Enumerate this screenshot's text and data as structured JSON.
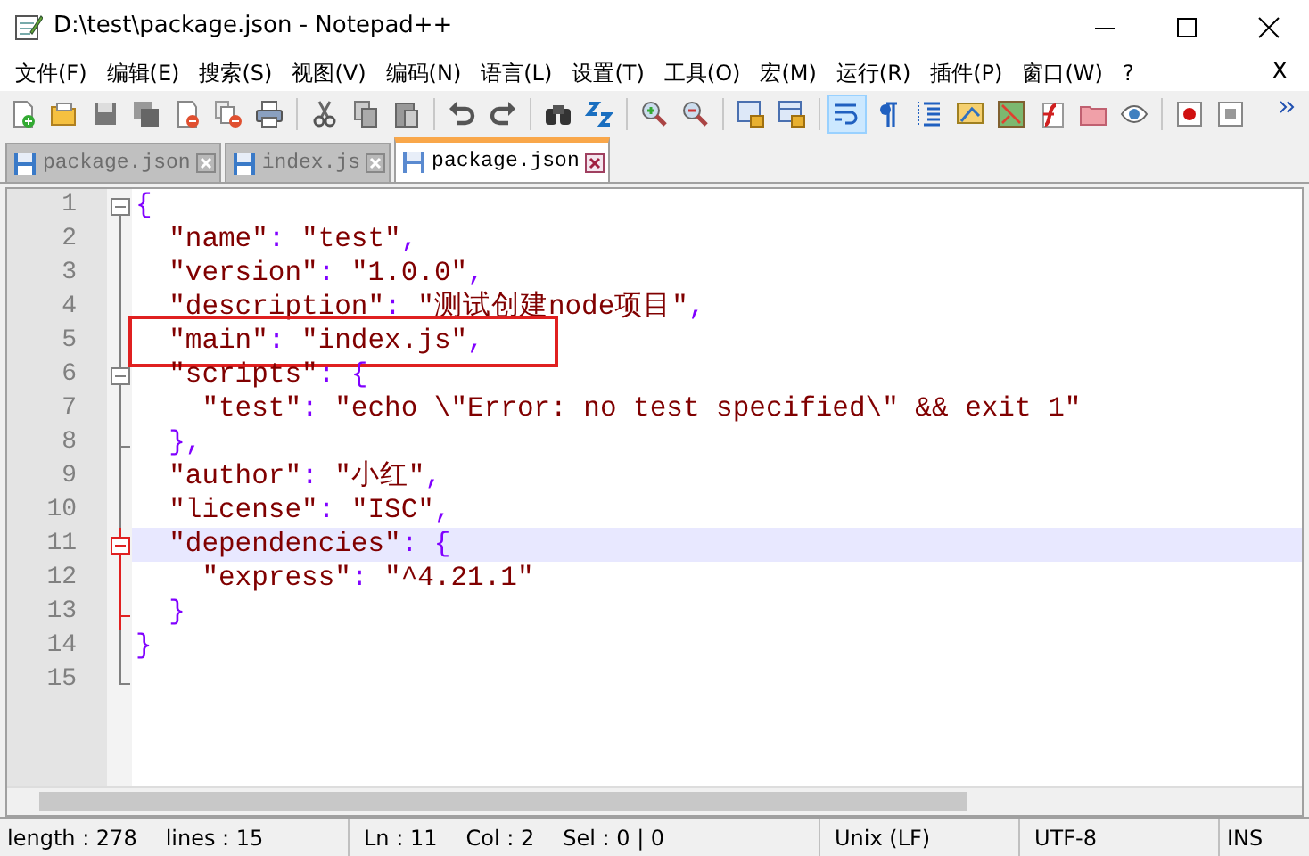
{
  "window": {
    "title": "D:\\test\\package.json - Notepad++"
  },
  "menu": [
    {
      "label": "文件(F)"
    },
    {
      "label": "编辑(E)"
    },
    {
      "label": "搜索(S)"
    },
    {
      "label": "视图(V)"
    },
    {
      "label": "编码(N)"
    },
    {
      "label": "语言(L)"
    },
    {
      "label": "设置(T)"
    },
    {
      "label": "工具(O)"
    },
    {
      "label": "宏(M)"
    },
    {
      "label": "运行(R)"
    },
    {
      "label": "插件(P)"
    },
    {
      "label": "窗口(W)"
    },
    {
      "label": "?"
    }
  ],
  "menu_close": "X",
  "toolbar": [
    {
      "pressed": false
    },
    {
      "pressed": false
    },
    {
      "pressed": false
    },
    {
      "pressed": false
    },
    {
      "pressed": false
    },
    {
      "pressed": false
    },
    {
      "pressed": false
    },
    {
      "pressed": false
    },
    {
      "pressed": false
    },
    {
      "pressed": false
    },
    {
      "pressed": false
    },
    {
      "pressed": false
    },
    {
      "pressed": false
    },
    {
      "pressed": false
    },
    {
      "pressed": false
    },
    {
      "pressed": false
    },
    {
      "pressed": false
    },
    {
      "pressed": false
    },
    {
      "pressed": true
    },
    {
      "pressed": false
    },
    {
      "pressed": false
    },
    {
      "pressed": false
    },
    {
      "pressed": false
    },
    {
      "pressed": false
    },
    {
      "pressed": false
    },
    {
      "pressed": false
    },
    {
      "pressed": false
    },
    {
      "pressed": false
    }
  ],
  "tabs": [
    {
      "label": "package.json",
      "selected": false
    },
    {
      "label": "index.js",
      "selected": false
    },
    {
      "label": "package.json",
      "selected": true
    }
  ],
  "editor": {
    "lines": [
      {
        "number": "1",
        "fold_start": true,
        "fold_end": false,
        "fold_active": false,
        "current": false,
        "boxed": false,
        "tokens": [
          {
            "text": "{",
            "kind": "punct"
          }
        ]
      },
      {
        "number": "2",
        "fold_start": false,
        "fold_end": false,
        "fold_active": false,
        "current": false,
        "boxed": false,
        "tokens": [
          {
            "text": "  \"name\"",
            "kind": "str"
          },
          {
            "text": ": ",
            "kind": "punct"
          },
          {
            "text": "\"test\"",
            "kind": "str"
          },
          {
            "text": ",",
            "kind": "punct"
          }
        ]
      },
      {
        "number": "3",
        "fold_start": false,
        "fold_end": false,
        "fold_active": false,
        "current": false,
        "boxed": false,
        "tokens": [
          {
            "text": "  \"version\"",
            "kind": "str"
          },
          {
            "text": ": ",
            "kind": "punct"
          },
          {
            "text": "\"1.0.0\"",
            "kind": "str"
          },
          {
            "text": ",",
            "kind": "punct"
          }
        ]
      },
      {
        "number": "4",
        "fold_start": false,
        "fold_end": false,
        "fold_active": false,
        "current": false,
        "boxed": false,
        "tokens": [
          {
            "text": "  \"description\"",
            "kind": "str"
          },
          {
            "text": ": ",
            "kind": "punct"
          },
          {
            "text": "\"测试创建node项目\"",
            "kind": "str"
          },
          {
            "text": ",",
            "kind": "punct"
          }
        ]
      },
      {
        "number": "5",
        "fold_start": false,
        "fold_end": false,
        "fold_active": false,
        "current": false,
        "boxed": true,
        "tokens": [
          {
            "text": "  \"main\"",
            "kind": "str"
          },
          {
            "text": ": ",
            "kind": "punct"
          },
          {
            "text": "\"index.js\"",
            "kind": "str"
          },
          {
            "text": ",",
            "kind": "punct"
          }
        ]
      },
      {
        "number": "6",
        "fold_start": true,
        "fold_end": false,
        "fold_active": false,
        "current": false,
        "boxed": false,
        "tokens": [
          {
            "text": "  \"scripts\"",
            "kind": "str"
          },
          {
            "text": ": {",
            "kind": "punct"
          }
        ]
      },
      {
        "number": "7",
        "fold_start": false,
        "fold_end": false,
        "fold_active": false,
        "current": false,
        "boxed": false,
        "tokens": [
          {
            "text": "    \"test\"",
            "kind": "str"
          },
          {
            "text": ": ",
            "kind": "punct"
          },
          {
            "text": "\"echo \\\"Error: no test specified\\\" && exit 1\"",
            "kind": "str"
          }
        ]
      },
      {
        "number": "8",
        "fold_start": false,
        "fold_end": true,
        "fold_active": false,
        "current": false,
        "boxed": false,
        "tokens": [
          {
            "text": "  },",
            "kind": "punct"
          }
        ]
      },
      {
        "number": "9",
        "fold_start": false,
        "fold_end": false,
        "fold_active": false,
        "current": false,
        "boxed": false,
        "tokens": [
          {
            "text": "  \"author\"",
            "kind": "str"
          },
          {
            "text": ": ",
            "kind": "punct"
          },
          {
            "text": "\"小红\"",
            "kind": "str"
          },
          {
            "text": ",",
            "kind": "punct"
          }
        ]
      },
      {
        "number": "10",
        "fold_start": false,
        "fold_end": false,
        "fold_active": false,
        "current": false,
        "boxed": false,
        "tokens": [
          {
            "text": "  \"license\"",
            "kind": "str"
          },
          {
            "text": ": ",
            "kind": "punct"
          },
          {
            "text": "\"ISC\"",
            "kind": "str"
          },
          {
            "text": ",",
            "kind": "punct"
          }
        ]
      },
      {
        "number": "11",
        "fold_start": true,
        "fold_end": false,
        "fold_active": true,
        "current": true,
        "boxed": false,
        "tokens": [
          {
            "text": "  \"dependencies\"",
            "kind": "str"
          },
          {
            "text": ": {",
            "kind": "punct"
          }
        ]
      },
      {
        "number": "12",
        "fold_start": false,
        "fold_end": false,
        "fold_active": true,
        "current": false,
        "boxed": false,
        "tokens": [
          {
            "text": "    \"express\"",
            "kind": "str"
          },
          {
            "text": ": ",
            "kind": "punct"
          },
          {
            "text": "\"^4.21.1\"",
            "kind": "str"
          }
        ]
      },
      {
        "number": "13",
        "fold_start": false,
        "fold_end": true,
        "fold_active": true,
        "current": false,
        "boxed": false,
        "tokens": [
          {
            "text": "  }",
            "kind": "punct"
          }
        ]
      },
      {
        "number": "14",
        "fold_start": false,
        "fold_end": false,
        "fold_active": false,
        "current": false,
        "boxed": false,
        "tokens": [
          {
            "text": "}",
            "kind": "punct"
          }
        ]
      },
      {
        "number": "15",
        "fold_start": false,
        "fold_end": true,
        "fold_active": false,
        "current": false,
        "boxed": false
      }
    ]
  },
  "status_bar": {
    "length": "length : 278",
    "lines": "lines : 15",
    "ln": "Ln : 11",
    "col": "Col : 2",
    "sel": "Sel : 0 | 0",
    "eol": "Unix (LF)",
    "encoding": "UTF-8",
    "mode": "INS"
  }
}
